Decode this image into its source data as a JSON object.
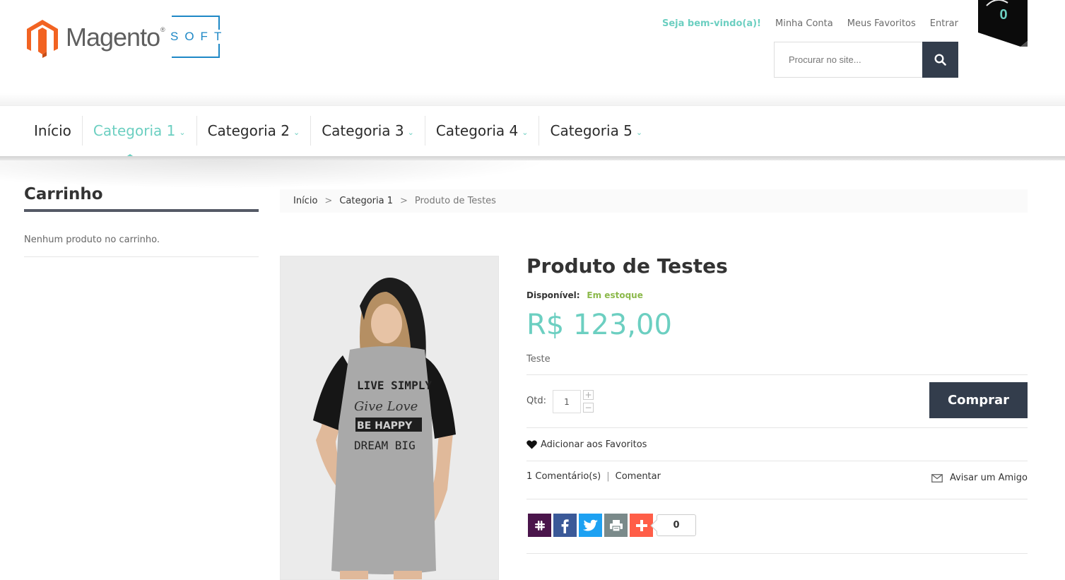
{
  "header": {
    "logo": {
      "brand": "Magento",
      "reg": "®",
      "sub": "SOFT"
    },
    "toplinks": {
      "welcome": "Seja bem-vindo(a)!",
      "account": "Minha Conta",
      "favorites": "Meus Favoritos",
      "login": "Entrar"
    },
    "search": {
      "placeholder": "Procurar no site..."
    },
    "cart_count": "0"
  },
  "nav": {
    "items": [
      {
        "label": "Início"
      },
      {
        "label": "Categoria 1"
      },
      {
        "label": "Categoria 2"
      },
      {
        "label": "Categoria 3"
      },
      {
        "label": "Categoria 4"
      },
      {
        "label": "Categoria 5"
      }
    ],
    "active_index": 1
  },
  "sidebar": {
    "title": "Carrinho",
    "empty_text": "Nenhum produto no carrinho."
  },
  "breadcrumb": {
    "items": [
      "Início",
      "Categoria 1",
      "Produto de Testes"
    ],
    "separator": ">"
  },
  "product": {
    "title": "Produto de Testes",
    "availability_label": "Disponível:",
    "availability_value": "Em estoque",
    "price": "R$ 123,00",
    "description": "Teste",
    "qty_label": "Qtd:",
    "qty_value": "1",
    "buy_label": "Comprar",
    "favorite_label": "Adicionar aos Favoritos",
    "comments_label": "1 Comentário(s)",
    "comment_link": "Comentar",
    "tell_friend": "Avisar um Amigo",
    "share_count": "0",
    "image_text": [
      "LIVE SIMPLY",
      "Give Love",
      "BE HAPPY",
      "DREAM BIG"
    ]
  },
  "colors": {
    "accent": "#6ccfc1",
    "dark": "#333d4c",
    "instock": "#8cb94b",
    "magento_orange": "#f26322",
    "soft_blue": "#1e88c6"
  }
}
